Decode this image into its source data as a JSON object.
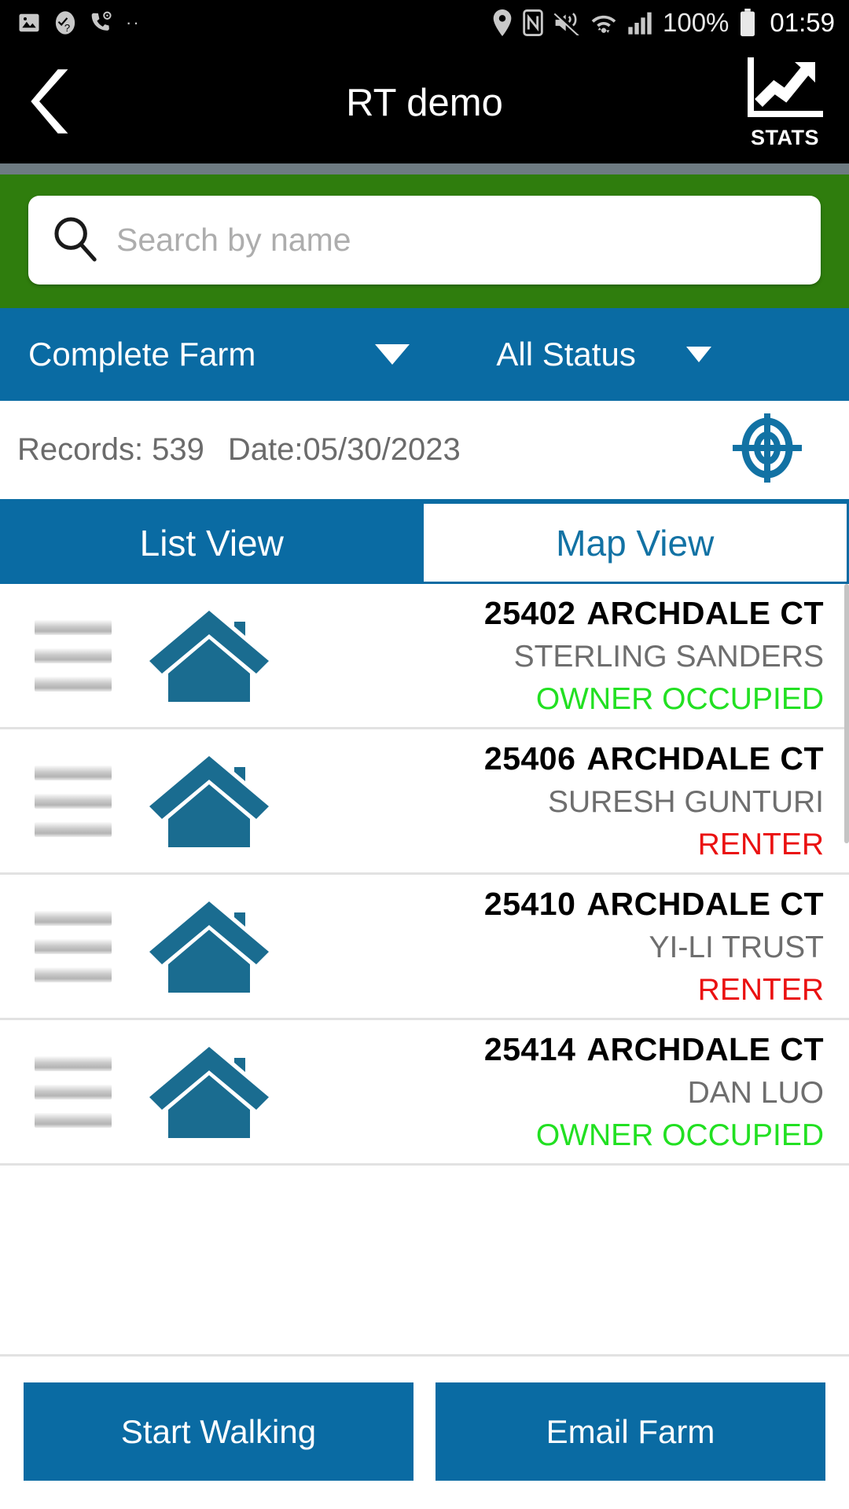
{
  "status_bar": {
    "left_icons": [
      "image-icon",
      "help-check-icon",
      "phone-location-icon",
      "more-dots-icon"
    ],
    "right_icons": [
      "location-pin-icon",
      "nfc-icon",
      "vibrate-mute-icon",
      "wifi-icon",
      "signal-bars-icon"
    ],
    "battery_percent": "100%",
    "battery_icon": "battery-full-icon",
    "clock": "01:59"
  },
  "app_bar": {
    "back_icon": "back-chevron-icon",
    "title": "RT demo",
    "stats_icon": "stats-chart-icon",
    "stats_label": "STATS"
  },
  "search": {
    "icon": "search-icon",
    "placeholder": "Search by name",
    "value": ""
  },
  "filters": {
    "farm": {
      "label": "Complete Farm",
      "caret_icon": "chevron-down-icon"
    },
    "status": {
      "label": "All Status",
      "caret_icon": "chevron-down-icon"
    }
  },
  "info": {
    "records": "Records: 539",
    "date": "Date:05/30/2023",
    "gps_icon": "crosshair-target-icon"
  },
  "tabs": [
    {
      "label": "List View",
      "active": true
    },
    {
      "label": "Map View",
      "active": false
    }
  ],
  "list": [
    {
      "handle_icon": "drag-handle-icon",
      "house_icon": "house-icon",
      "number": "25402",
      "street": "ARCHDALE CT",
      "owner": "STERLING SANDERS",
      "status": "OWNER OCCUPIED",
      "status_type": "owner"
    },
    {
      "handle_icon": "drag-handle-icon",
      "house_icon": "house-icon",
      "number": "25406",
      "street": "ARCHDALE CT",
      "owner": "SURESH GUNTURI",
      "status": "RENTER",
      "status_type": "renter"
    },
    {
      "handle_icon": "drag-handle-icon",
      "house_icon": "house-icon",
      "number": "25410",
      "street": "ARCHDALE CT",
      "owner": "YI-LI TRUST",
      "status": "RENTER",
      "status_type": "renter"
    },
    {
      "handle_icon": "drag-handle-icon",
      "house_icon": "house-icon",
      "number": "25414",
      "street": "ARCHDALE CT",
      "owner": "DAN LUO",
      "status": "OWNER OCCUPIED",
      "status_type": "owner"
    }
  ],
  "bottom_actions": {
    "start_walking": "Start Walking",
    "email_farm": "Email Farm"
  },
  "colors": {
    "app_bar": "#000000",
    "search_band": "#2f7d0d",
    "primary_blue": "#0a6ba3",
    "house_blue": "#1a6c90",
    "owner_green": "#22e022",
    "renter_red": "#ea1111",
    "muted_gray": "#6e6e6e"
  }
}
